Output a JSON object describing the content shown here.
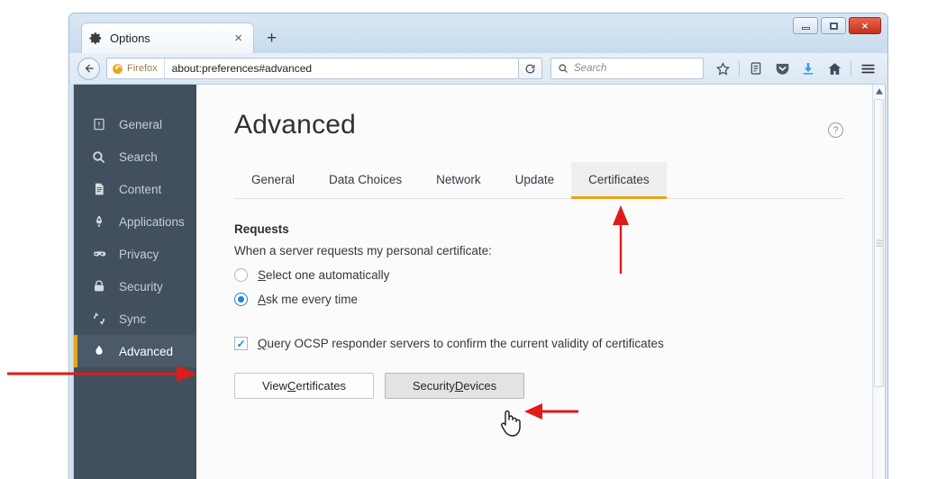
{
  "window": {
    "controls": {
      "minimize": "Minimize",
      "maximize": "Maximize",
      "close": "×"
    }
  },
  "browser": {
    "tab": {
      "title": "Options",
      "icon": "gear-icon",
      "close_label": "×"
    },
    "new_tab_label": "+",
    "back_label": "Back",
    "identity_label": "Firefox",
    "url": "about:preferences#advanced",
    "reload_label": "Reload",
    "search": {
      "placeholder": "Search",
      "icon": "search-icon"
    },
    "toolbar_icons": [
      {
        "name": "bookmark-star-icon",
        "label": "Bookmark this page"
      },
      {
        "name": "library-icon",
        "label": "Show your bookmarks"
      },
      {
        "name": "pocket-icon",
        "label": "Save to Pocket"
      },
      {
        "name": "downloads-icon",
        "label": "Downloads"
      },
      {
        "name": "home-icon",
        "label": "Home"
      },
      {
        "name": "hamburger-menu-icon",
        "label": "Open menu"
      }
    ]
  },
  "sidebar": {
    "items": [
      {
        "label": "General",
        "icon": "general-icon",
        "active": false
      },
      {
        "label": "Search",
        "icon": "search-icon",
        "active": false
      },
      {
        "label": "Content",
        "icon": "content-page-icon",
        "active": false
      },
      {
        "label": "Applications",
        "icon": "applications-rocket-icon",
        "active": false
      },
      {
        "label": "Privacy",
        "icon": "privacy-mask-icon",
        "active": false
      },
      {
        "label": "Security",
        "icon": "security-lock-icon",
        "active": false
      },
      {
        "label": "Sync",
        "icon": "sync-arrows-icon",
        "active": false
      },
      {
        "label": "Advanced",
        "icon": "advanced-flask-icon",
        "active": true
      }
    ]
  },
  "page": {
    "title": "Advanced",
    "help_icon_label": "?",
    "tabs": [
      {
        "label": "General",
        "active": false
      },
      {
        "label": "Data Choices",
        "active": false
      },
      {
        "label": "Network",
        "active": false
      },
      {
        "label": "Update",
        "active": false
      },
      {
        "label": "Certificates",
        "active": true
      }
    ],
    "section": {
      "heading": "Requests",
      "description": "When a server requests my personal certificate:",
      "radios": [
        {
          "label_prefix": "",
          "accesskey": "S",
          "label_rest": "elect one automatically",
          "selected": false
        },
        {
          "label_prefix": "",
          "accesskey": "A",
          "label_rest": "sk me every time",
          "selected": true
        }
      ],
      "checkbox": {
        "accesskey": "Q",
        "label_rest": "uery OCSP responder servers to confirm the current validity of certificates",
        "checked": true,
        "check_glyph": "✓"
      },
      "buttons": [
        {
          "label_prefix": "View ",
          "accesskey": "C",
          "label_rest": "ertificates",
          "hovered": false
        },
        {
          "label_prefix": "Security ",
          "accesskey": "D",
          "label_rest": "evices",
          "hovered": true
        }
      ]
    }
  },
  "annotations": {
    "accent_color": "#e01b18",
    "arrows": [
      {
        "name": "arrow-pointing-to-advanced-sidebar-item",
        "direction": "right"
      },
      {
        "name": "arrow-pointing-to-certificates-tab",
        "direction": "up"
      },
      {
        "name": "arrow-pointing-to-security-devices-button",
        "direction": "left"
      }
    ],
    "cursor": {
      "name": "hand-pointer-cursor"
    }
  },
  "colors": {
    "sidebar_bg": "#424f5e",
    "sidebar_active_bg": "#4b5969",
    "accent_orange": "#e8a317",
    "radio_blue": "#1a84d6",
    "annotation_red": "#e01b18"
  }
}
